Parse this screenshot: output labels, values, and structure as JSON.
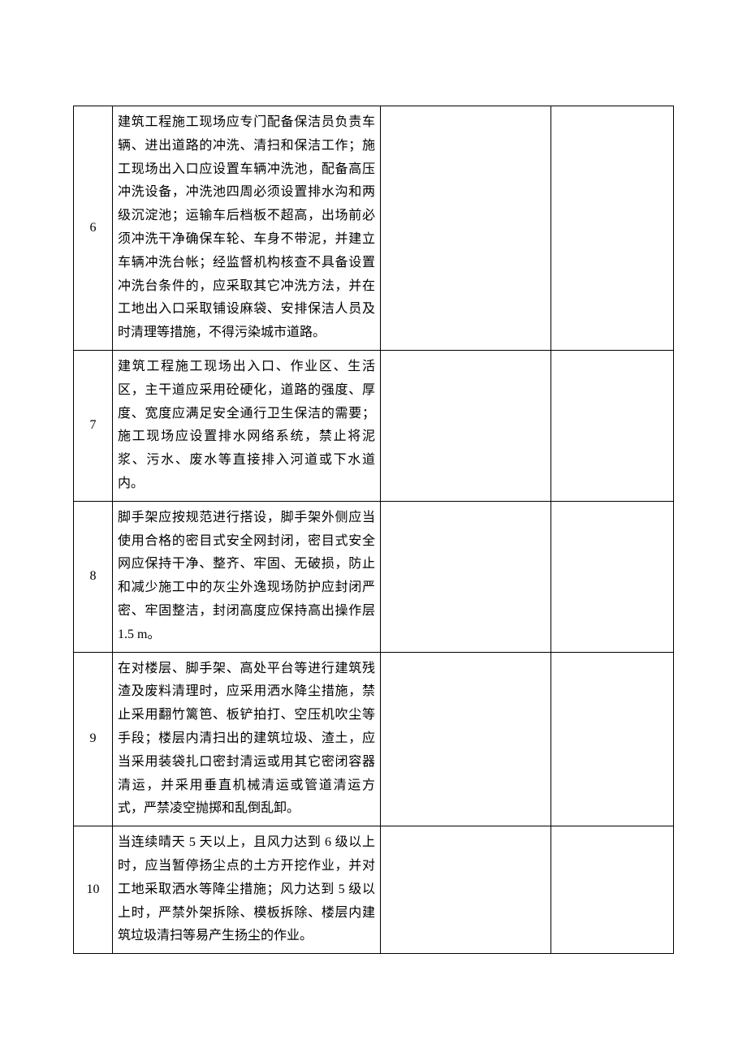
{
  "rows": [
    {
      "index": "6",
      "desc": "建筑工程施工现场应专门配备保洁员负责车辆、进出道路的冲洗、清扫和保洁工作；施工现场出入口应设置车辆冲洗池，配备高压冲洗设备，冲洗池四周必须设置排水沟和两级沉淀池；运输车后档板不超高，出场前必须冲洗干净确保车轮、车身不带泥，并建立车辆冲洗台帐；经监督机构核查不具备设置冲洗台条件的，应采取其它冲洗方法，并在工地出入口采取铺设麻袋、安排保洁人员及时清理等措施，不得污染城市道路。",
      "col3": "",
      "col4": ""
    },
    {
      "index": "7",
      "desc": "建筑工程施工现场出入口、作业区、生活区，主干道应采用砼硬化，道路的强度、厚度、宽度应满足安全通行卫生保洁的需要；施工现场应设置排水网络系统，禁止将泥浆、污水、废水等直接排入河道或下水道内。",
      "col3": "",
      "col4": ""
    },
    {
      "index": "8",
      "desc_parts": [
        "脚手架应按规范进行搭设，脚手架外侧应当使用合格的密目式安全网封闭，密目式安全网应保持干净、整齐、牢固、无破损，防止和减少施工中的灰尘外逸现场防护应封闭严密、牢固整洁，封闭高度应保持高出操作层 ",
        "1.5 m",
        "。"
      ],
      "col3": "",
      "col4": ""
    },
    {
      "index": "9",
      "desc": "在对楼层、脚手架、高处平台等进行建筑残渣及废料清理时，应采用洒水降尘措施，禁止采用翻竹篱笆、板铲拍打、空压机吹尘等手段；楼层内清扫出的建筑垃圾、渣土，应当采用装袋扎口密封清运或用其它密闭容器清运，并采用垂直机械清运或管道清运方式，严禁凌空抛掷和乱倒乱卸。",
      "col3": "",
      "col4": ""
    },
    {
      "index": "10",
      "desc_parts": [
        "当连续晴天 ",
        "5",
        " 天以上，且风力达到 ",
        "6",
        " 级以上时，应当暂停扬尘点的土方开挖作业，并对工地采取洒水等降尘措施；风力达到 ",
        "5",
        " 级以上时，严禁外架拆除、模板拆除、楼层内建筑垃圾清扫等易产生扬尘的作业。"
      ],
      "col3": "",
      "col4": ""
    }
  ]
}
